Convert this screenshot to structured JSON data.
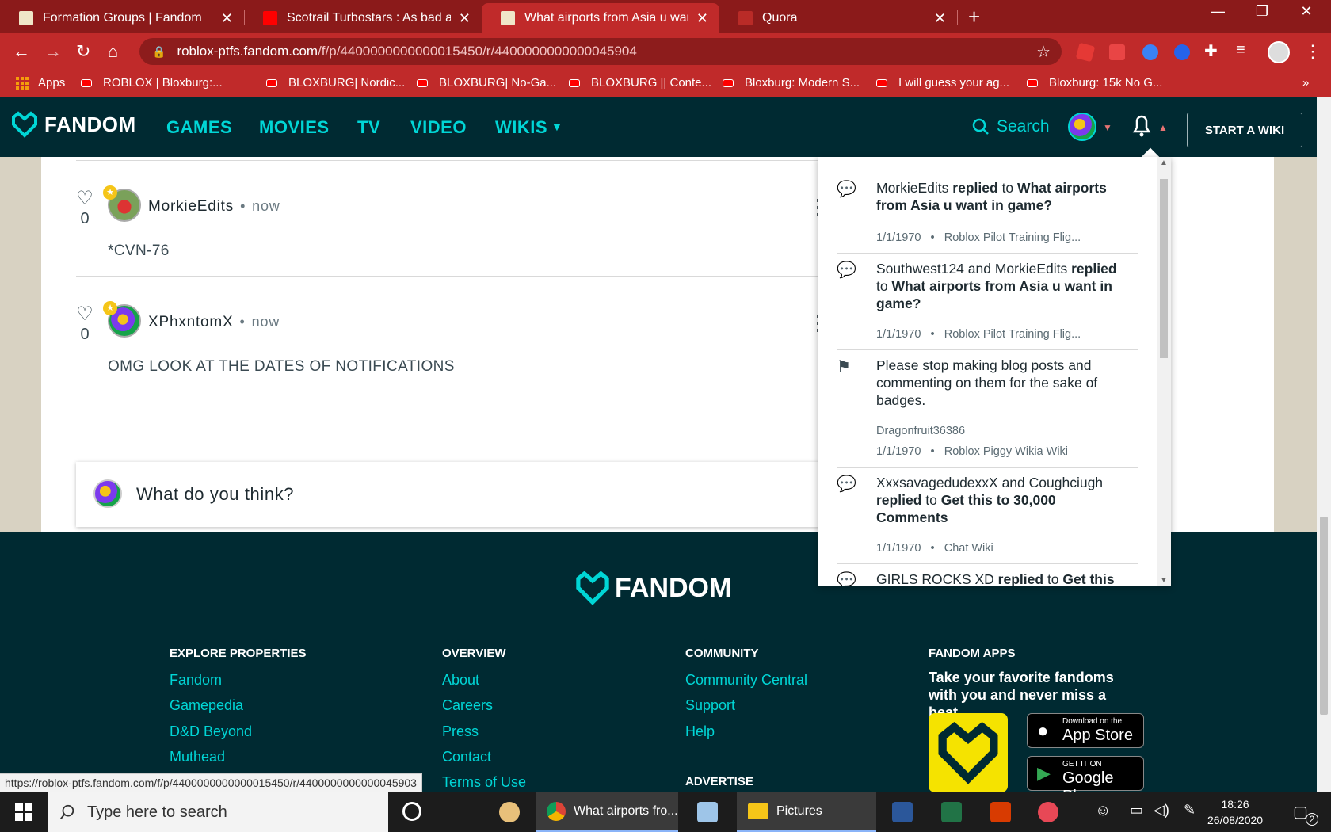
{
  "browser": {
    "tabs": [
      {
        "title": "Formation Groups | Fandom",
        "favicon_color": "#f0e6c8"
      },
      {
        "title": "Scotrail Turbostars : As bad as yo",
        "favicon_color": "#ff0000"
      },
      {
        "title": "What airports from Asia u want in",
        "favicon_color": "#f0e6c8"
      },
      {
        "title": "Quora",
        "favicon_color": "#b92b27"
      }
    ],
    "close_glyph": "✕",
    "new_tab_glyph": "+",
    "window_controls": [
      "—",
      "❐",
      "✕"
    ],
    "url_host": "roblox-ptfs.fandom.com",
    "url_path": "/f/p/4400000000000015450/r/4400000000000045904",
    "bookmarks": [
      {
        "label": "Apps"
      },
      {
        "label": "ROBLOX | Bloxburg:..."
      },
      {
        "label": "BLOXBURG| Nordic..."
      },
      {
        "label": "BLOXBURG| No-Ga..."
      },
      {
        "label": "BLOXBURG || Conte..."
      },
      {
        "label": "Bloxburg: Modern S..."
      },
      {
        "label": "I will guess your ag..."
      },
      {
        "label": "Bloxburg: 15k No G..."
      }
    ],
    "bookmarks_more": "»",
    "status_url": "https://roblox-ptfs.fandom.com/f/p/4400000000000015450/r/4400000000000045903"
  },
  "fandom": {
    "logo": "FANDOM",
    "nav": [
      "GAMES",
      "MOVIES",
      "TV",
      "VIDEO",
      "WIKIS"
    ],
    "search_label": "Search",
    "start_wiki": "START A WIKI"
  },
  "comments": [
    {
      "username": "MorkieEdits",
      "time": "now",
      "likes": "0",
      "text": "*CVN-76",
      "avatar_color": "#5a8a3a"
    },
    {
      "username": "XPhxntomX",
      "time": "now",
      "likes": "0",
      "text": "OMG LOOK AT THE DATES OF NOTIFICATIONS",
      "avatar_color": "#7c3aed"
    }
  ],
  "reply_placeholder": "What do you think?",
  "notifications": [
    {
      "icon": "comment-icon",
      "actors": "MorkieEdits",
      "action": "replied",
      "connector": "to",
      "target": "What airports from Asia u want in game?",
      "extra": "",
      "date": "1/1/1970",
      "wiki": "Roblox Pilot Training Flig..."
    },
    {
      "icon": "comment-icon",
      "actors": "Southwest124 and MorkieEdits",
      "action": "replied",
      "connector": "to",
      "target": "What airports from Asia u want in game?",
      "extra": "",
      "date": "1/1/1970",
      "wiki": "Roblox Pilot Training Flig..."
    },
    {
      "icon": "flag-icon",
      "actors": "Please stop making blog posts and commenting on them for the sake of badges.",
      "action": "",
      "connector": "",
      "target": "",
      "extra": "Dragonfruit36386",
      "date": "1/1/1970",
      "wiki": "Roblox Piggy Wikia Wiki"
    },
    {
      "icon": "comment-icon",
      "actors": "XxxsavagedudexxX and Coughciugh",
      "action": "replied",
      "connector": "to",
      "target": "Get this to 30,000 Comments",
      "extra": "",
      "date": "1/1/1970",
      "wiki": "Chat Wiki"
    },
    {
      "icon": "comment-icon",
      "actors": "GIRLS ROCKS XD",
      "action": "replied",
      "connector": "to",
      "target": "Get this",
      "extra": "",
      "date": "",
      "wiki": ""
    }
  ],
  "meta_separator": "•",
  "footer": {
    "logo": "FANDOM",
    "columns": [
      {
        "heading": "EXPLORE PROPERTIES",
        "links": [
          "Fandom",
          "Gamepedia",
          "D&D Beyond",
          "Muthead"
        ]
      },
      {
        "heading": "OVERVIEW",
        "links": [
          "About",
          "Careers",
          "Press",
          "Contact",
          "Terms of Use"
        ]
      },
      {
        "heading": "COMMUNITY",
        "links": [
          "Community Central",
          "Support",
          "Help"
        ]
      },
      {
        "heading": "FANDOM APPS",
        "links": []
      }
    ],
    "advertise_heading": "ADVERTISE",
    "apps_text": "Take your favorite fandoms with you and never miss a beat.",
    "app_store_small": "Download on the",
    "app_store_big": "App Store",
    "play_small": "GET IT ON",
    "play_big": "Google Play"
  },
  "taskbar": {
    "search_placeholder": "Type here to search",
    "chrome_task": "What airports fro...",
    "explorer_task": "Pictures",
    "time": "18:26",
    "date": "26/08/2020",
    "notification_count": "2"
  }
}
